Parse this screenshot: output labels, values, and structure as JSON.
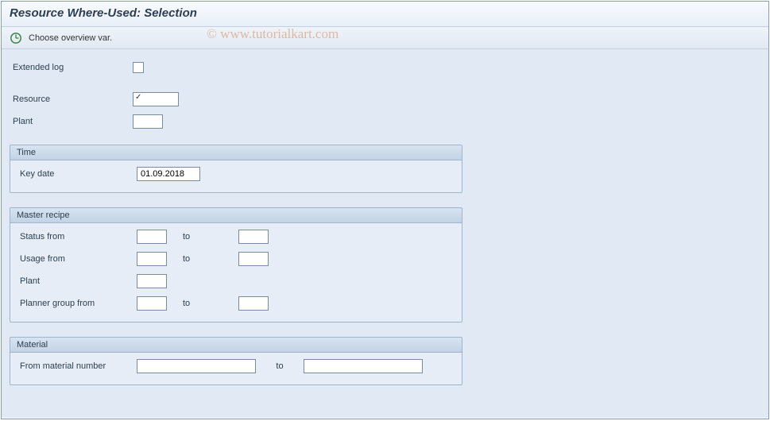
{
  "header": {
    "title": "Resource Where-Used: Selection"
  },
  "toolbar": {
    "choose_label": "Choose overview var."
  },
  "watermark": "© www.tutorialkart.com",
  "top": {
    "extended_log_label": "Extended log",
    "extended_log_checked": false,
    "resource_label": "Resource",
    "resource_value": "",
    "plant_label": "Plant",
    "plant_value": ""
  },
  "time_group": {
    "title": "Time",
    "key_date_label": "Key date",
    "key_date_value": "01.09.2018"
  },
  "master_recipe_group": {
    "title": "Master recipe",
    "status_from_label": "Status from",
    "status_from_value": "",
    "status_to_label": "to",
    "status_to_value": "",
    "usage_from_label": "Usage from",
    "usage_from_value": "",
    "usage_to_label": "to",
    "usage_to_value": "",
    "plant_label": "Plant",
    "plant_value": "",
    "planner_group_from_label": "Planner group from",
    "planner_group_from_value": "",
    "planner_group_to_label": "to",
    "planner_group_to_value": ""
  },
  "material_group": {
    "title": "Material",
    "from_material_label": "From material number",
    "from_material_value": "",
    "to_label": "to",
    "to_material_value": ""
  }
}
